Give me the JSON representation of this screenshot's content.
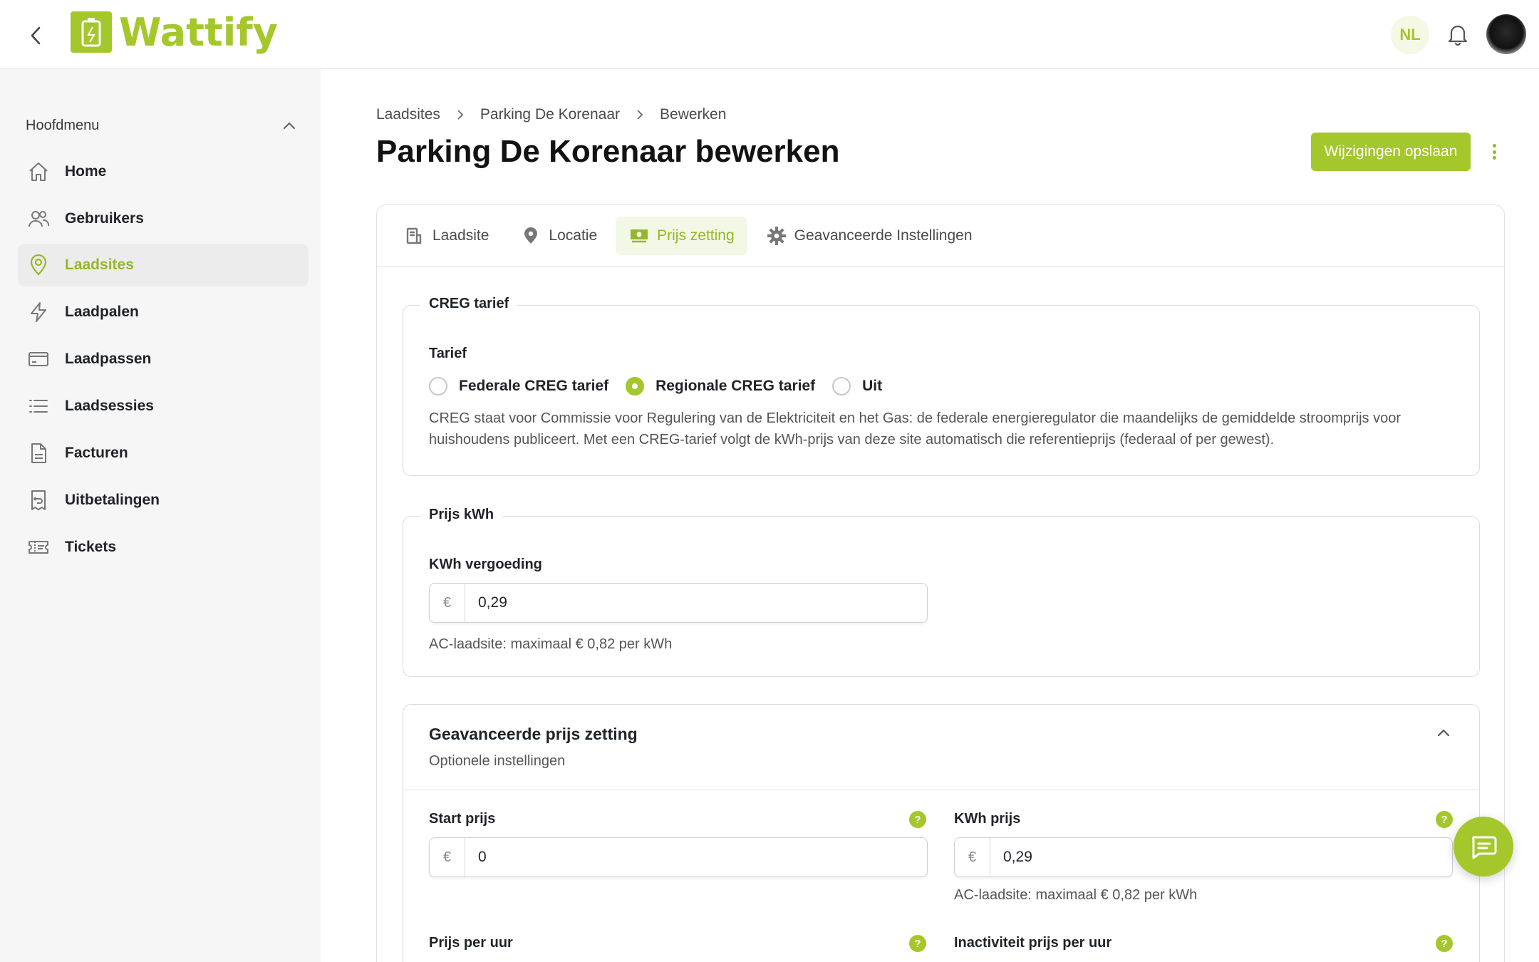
{
  "header": {
    "logo_text": "Wattify",
    "lang": "NL",
    "colors": {
      "brand": "#a4c72c"
    }
  },
  "sidebar": {
    "menu_title": "Hoofdmenu",
    "items": [
      {
        "label": "Home",
        "icon": "home-icon"
      },
      {
        "label": "Gebruikers",
        "icon": "users-icon"
      },
      {
        "label": "Laadsites",
        "icon": "map-pin-icon",
        "active": true
      },
      {
        "label": "Laadpalen",
        "icon": "lightning-icon"
      },
      {
        "label": "Laadpassen",
        "icon": "card-icon"
      },
      {
        "label": "Laadsessies",
        "icon": "list-icon"
      },
      {
        "label": "Facturen",
        "icon": "document-icon"
      },
      {
        "label": "Uitbetalingen",
        "icon": "receipt-icon"
      },
      {
        "label": "Tickets",
        "icon": "ticket-icon"
      }
    ]
  },
  "breadcrumb": [
    "Laadsites",
    "Parking De Korenaar",
    "Bewerken"
  ],
  "page": {
    "title": "Parking De Korenaar bewerken",
    "save_label": "Wijzigingen opslaan"
  },
  "tabs": [
    {
      "label": "Laadsite",
      "icon": "building-icon"
    },
    {
      "label": "Locatie",
      "icon": "location-icon"
    },
    {
      "label": "Prijs zetting",
      "icon": "money-icon",
      "active": true
    },
    {
      "label": "Geavanceerde Instellingen",
      "icon": "gear-icon"
    }
  ],
  "creg": {
    "legend": "CREG tarief",
    "label": "Tarief",
    "options": [
      "Federale CREG tarief",
      "Regionale CREG tarief",
      "Uit"
    ],
    "selected": "Regionale CREG tarief",
    "description_line1": "CREG staat voor Commissie voor Regulering van de Elektriciteit en het Gas: de federale energieregulator die maandelijks de gemiddelde stroomprijs voor",
    "description_line2": "huishoudens publiceert. Met een CREG-tarief volgt de kWh-prijs van deze site automatisch die referentieprijs (federaal of per gewest)."
  },
  "kwh": {
    "legend": "Prijs kWh",
    "label": "KWh vergoeding",
    "currency": "€",
    "value": "0,29",
    "hint": "AC-laadsite: maximaal € 0,82 per kWh"
  },
  "advanced": {
    "title": "Geavanceerde prijs zetting",
    "subtitle": "Optionele instellingen",
    "start_label": "Start prijs",
    "start_currency": "€",
    "start_value": "0",
    "kwh_label": "KWh prijs",
    "kwh_currency": "€",
    "kwh_value": "0,29",
    "kwh_hint": "AC-laadsite: maximaal € 0,82 per kWh",
    "hour_label": "Prijs per uur",
    "idle_label": "Inactiviteit prijs per uur",
    "help_glyph": "?"
  }
}
